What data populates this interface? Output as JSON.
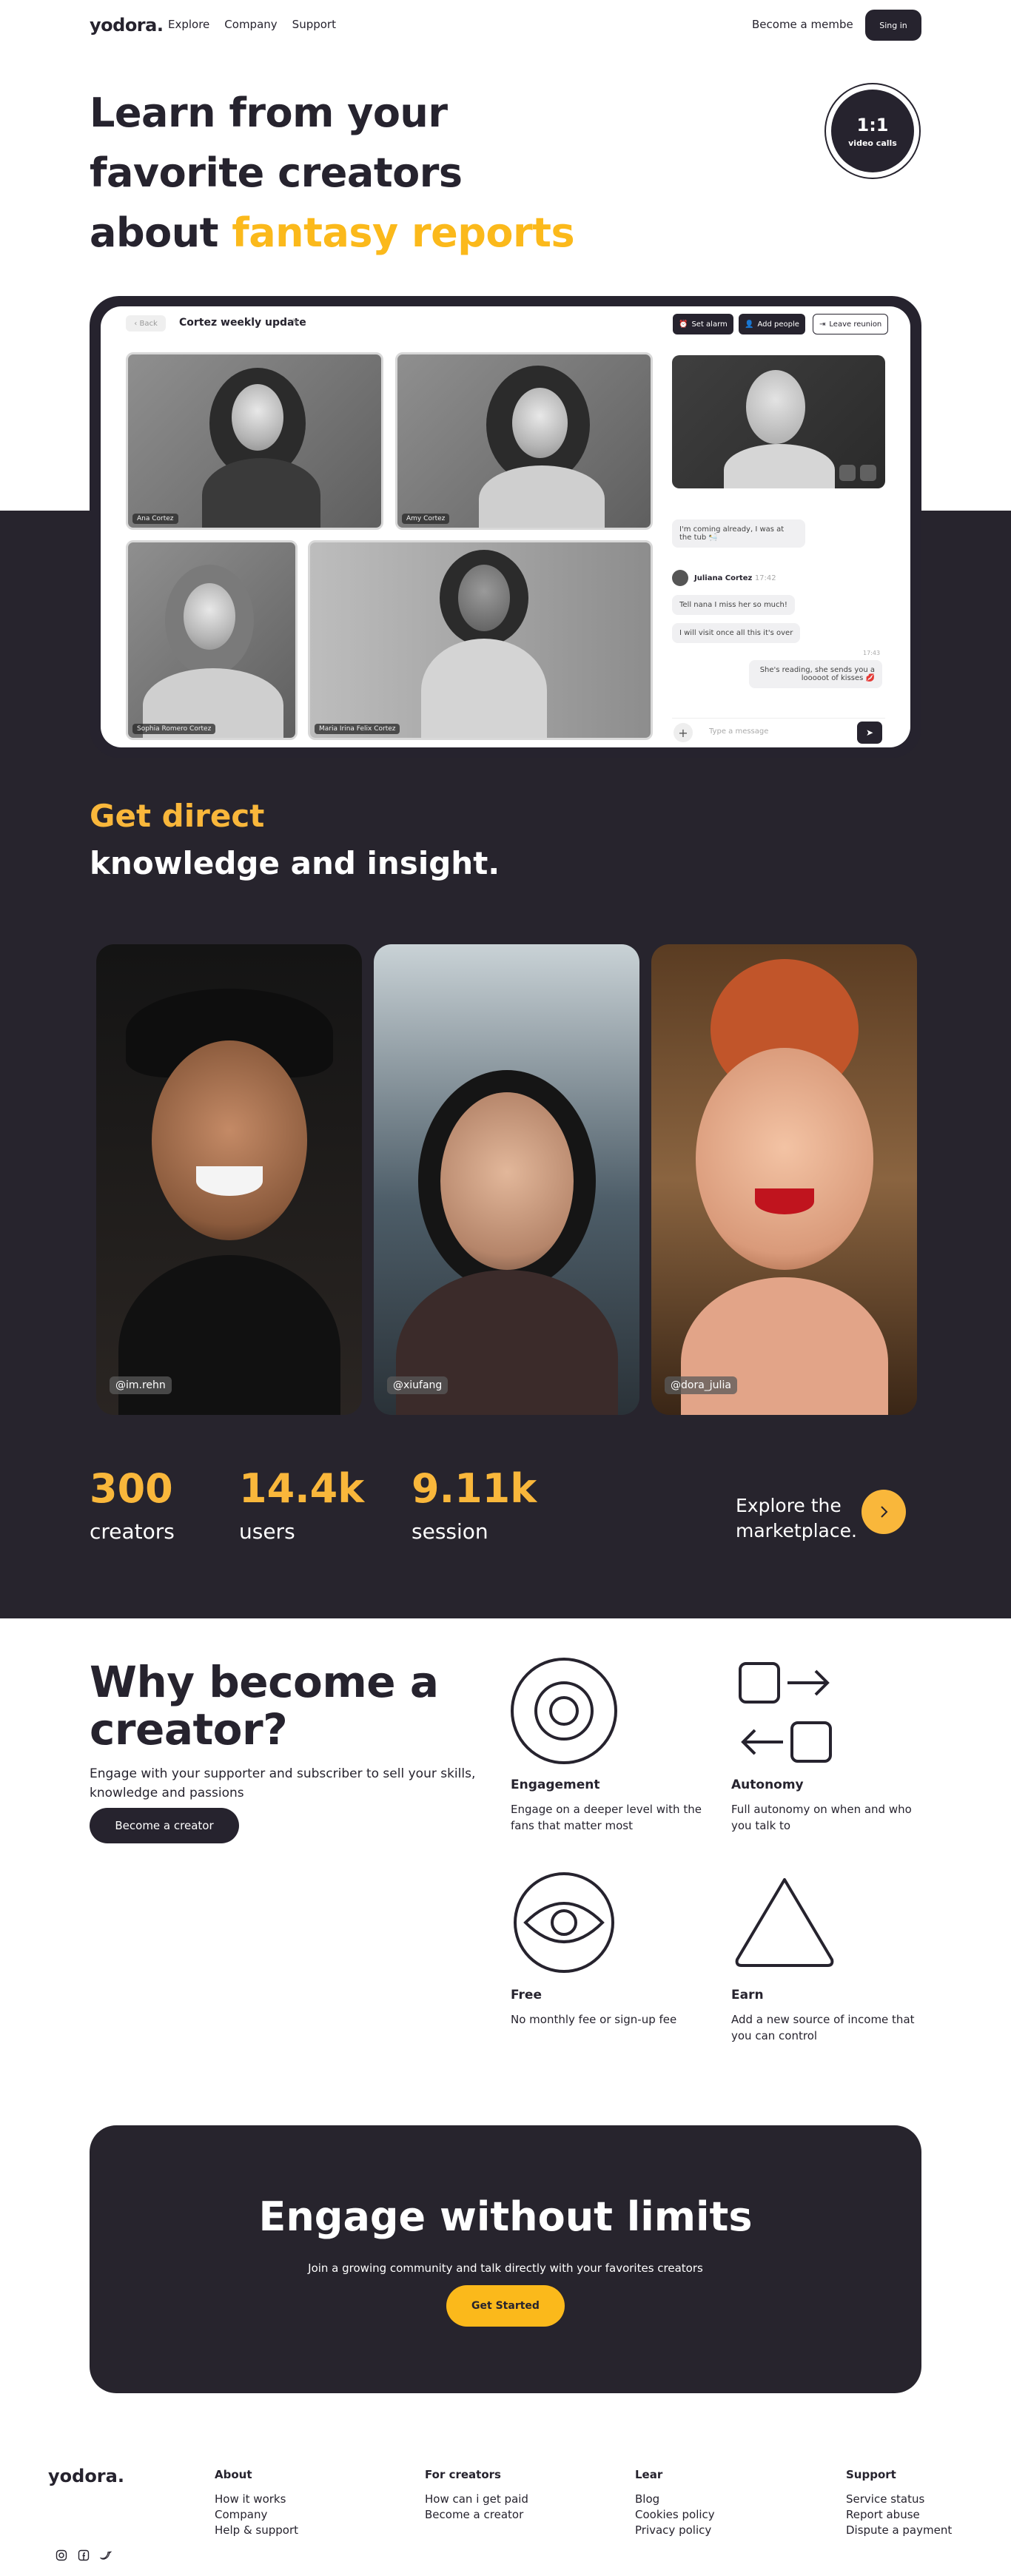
{
  "nav": {
    "logo": "yodora.",
    "links": [
      "Explore",
      "Company",
      "Support"
    ],
    "become": "Become a membe",
    "signin": "Sing in"
  },
  "hero": {
    "line1": "Learn from your",
    "line2": "favorite creators",
    "line3_prefix": "about ",
    "line3_accent": "fantasy reports"
  },
  "badge": {
    "top": "1:1",
    "bottom": "video calls"
  },
  "meeting": {
    "back": "Back",
    "title": "Cortez weekly update",
    "buttons": {
      "alarm": "Set alarm",
      "add": "Add people",
      "leave": "Leave reunion"
    },
    "tiles": [
      "Ana Cortez",
      "Amy Cortez",
      "Sophia Romero Cortez",
      "Maria Irina Felix Cortez"
    ],
    "chat": {
      "m1": "I'm coming already, I was at the tub 🛀",
      "name": "Juliana Cortez",
      "time": "17:42",
      "m2": "Tell nana I miss her so much!",
      "m3": "I will visit once all this it's over",
      "time2": "17:43",
      "m4": "She's reading, she sends you a looooot of kisses 💋",
      "placeholder": "Type a message"
    }
  },
  "direct": {
    "line1": "Get direct",
    "line2": "knowledge and insight."
  },
  "creators": [
    "@im.rehn",
    "@xiufang",
    "@dora_julia"
  ],
  "stats": [
    {
      "n": "300",
      "l": "creators"
    },
    {
      "n": "14.4k",
      "l": "users"
    },
    {
      "n": "9.11k",
      "l": "session"
    }
  ],
  "explore": {
    "line1": "Explore the",
    "line2": "marketplace."
  },
  "why": {
    "title1": "Why become a",
    "title2": "creator?",
    "desc": "Engage with your supporter and subscriber to sell your skills, knowledge and passions",
    "button": "Become a creator",
    "features": [
      {
        "title": "Engagement",
        "desc": "Engage on a deeper level with the fans that matter most"
      },
      {
        "title": "Autonomy",
        "desc": "Full autonomy on when and who you talk to"
      },
      {
        "title": "Free",
        "desc": "No monthly fee or sign-up fee"
      },
      {
        "title": "Earn",
        "desc": "Add a new source of income that you can control"
      }
    ]
  },
  "cta": {
    "title": "Engage without limits",
    "sub": "Join a growing community and talk directly with your favorites creators",
    "button": "Get Started"
  },
  "footer": {
    "logo": "yodora.",
    "cols": [
      {
        "h": "About",
        "items": [
          "How it works",
          "Company",
          "Help & support"
        ]
      },
      {
        "h": "For creators",
        "items": [
          "How can i get paid",
          "Become a creator"
        ]
      },
      {
        "h": "Lear",
        "items": [
          "Blog",
          "Cookies policy",
          "Privacy policy"
        ]
      },
      {
        "h": "Support",
        "items": [
          "Service status",
          "Report abuse",
          "Dispute a payment"
        ]
      }
    ]
  }
}
